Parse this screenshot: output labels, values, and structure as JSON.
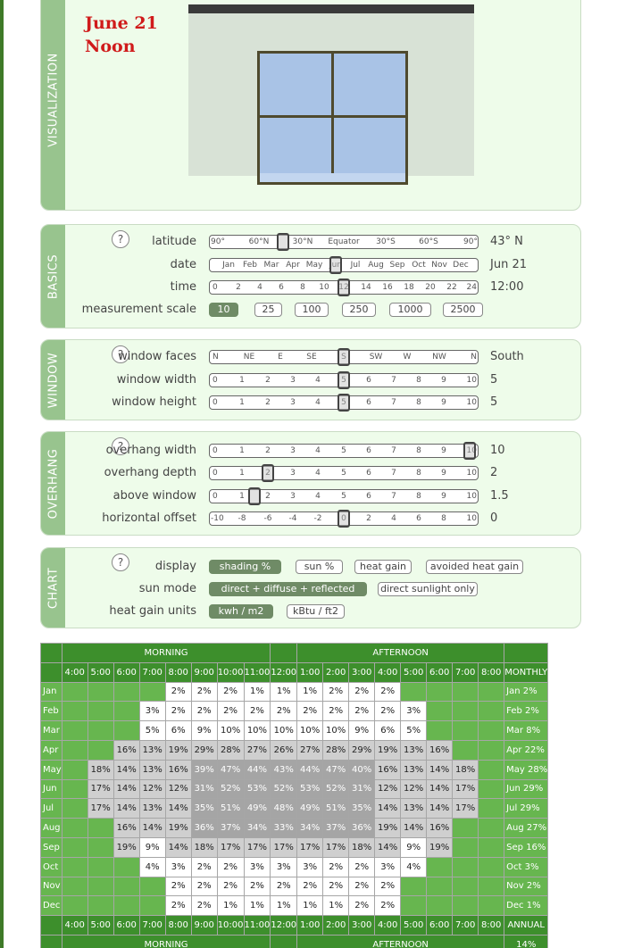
{
  "visualization": {
    "tab": "VISUALIZATION",
    "date_line": "June 21",
    "time_line": "Noon",
    "wall_color": "#d8e2d6",
    "glass_color": "#a9c3e6",
    "frame_color": "#4f4a2e"
  },
  "basics": {
    "tab": "BASICS",
    "help": "?",
    "latitude": {
      "label": "latitude",
      "ticks": [
        "90°",
        "60°N",
        "30°N",
        "Equator",
        "30°S",
        "60°S",
        "90°"
      ],
      "value": "43° N"
    },
    "date": {
      "label": "date",
      "ticks": [
        "Jan",
        "Feb",
        "Mar",
        "Apr",
        "May",
        "Jun",
        "Jul",
        "Aug",
        "Sep",
        "Oct",
        "Nov",
        "Dec"
      ],
      "value": "Jun 21"
    },
    "time": {
      "label": "time",
      "ticks": [
        "0",
        "2",
        "4",
        "6",
        "8",
        "10",
        "12",
        "14",
        "16",
        "18",
        "20",
        "22",
        "24"
      ],
      "value": "12:00"
    },
    "scale": {
      "label": "measurement scale",
      "options": [
        "10",
        "25",
        "100",
        "250",
        "1000",
        "2500"
      ],
      "selected": "10"
    }
  },
  "window": {
    "tab": "WINDOW",
    "help": "?",
    "faces": {
      "label": "window faces",
      "ticks": [
        "N",
        "NE",
        "E",
        "SE",
        "S",
        "SW",
        "W",
        "NW",
        "N"
      ],
      "value": "South"
    },
    "width": {
      "label": "window width",
      "ticks": [
        "0",
        "1",
        "2",
        "3",
        "4",
        "5",
        "6",
        "7",
        "8",
        "9",
        "10"
      ],
      "value": "5"
    },
    "height": {
      "label": "window height",
      "ticks": [
        "0",
        "1",
        "2",
        "3",
        "4",
        "5",
        "6",
        "7",
        "8",
        "9",
        "10"
      ],
      "value": "5"
    }
  },
  "overhang": {
    "tab": "OVERHANG",
    "help": "?",
    "width": {
      "label": "overhang width",
      "ticks": [
        "0",
        "1",
        "2",
        "3",
        "4",
        "5",
        "6",
        "7",
        "8",
        "9",
        "10"
      ],
      "value": "10"
    },
    "depth": {
      "label": "overhang depth",
      "ticks": [
        "0",
        "1",
        "2",
        "3",
        "4",
        "5",
        "6",
        "7",
        "8",
        "9",
        "10"
      ],
      "value": "2"
    },
    "above": {
      "label": "above window",
      "ticks": [
        "0",
        "1",
        "2",
        "3",
        "4",
        "5",
        "6",
        "7",
        "8",
        "9",
        "10"
      ],
      "value": "1.5"
    },
    "offset": {
      "label": "horizontal offset",
      "ticks": [
        "-10",
        "-8",
        "-6",
        "-4",
        "-2",
        "0",
        "2",
        "4",
        "6",
        "8",
        "10"
      ],
      "value": "0"
    }
  },
  "chart_controls": {
    "tab": "CHART",
    "help": "?",
    "display": {
      "label": "display",
      "options": [
        "shading %",
        "sun %",
        "heat gain",
        "avoided heat gain"
      ],
      "selected": "shading %"
    },
    "sun_mode": {
      "label": "sun mode",
      "options": [
        "direct + diffuse + reflected",
        "direct sunlight only"
      ],
      "selected": "direct + diffuse + reflected"
    },
    "units": {
      "label": "heat gain units",
      "options": [
        "kwh / m2",
        "kBtu / ft2"
      ],
      "selected": "kwh / m2"
    }
  },
  "table": {
    "morning": "MORNING",
    "afternoon": "AFTERNOON",
    "monthly": "MONTHLY",
    "annual": "ANNUAL",
    "annual_value": "14%",
    "hours": [
      "4:00",
      "5:00",
      "6:00",
      "7:00",
      "8:00",
      "9:00",
      "10:00",
      "11:00",
      "12:00",
      "1:00",
      "2:00",
      "3:00",
      "4:00",
      "5:00",
      "6:00",
      "7:00",
      "8:00"
    ],
    "rows": [
      {
        "month": "Jan",
        "cells": [
          "",
          "",
          "",
          "",
          "2%",
          "2%",
          "2%",
          "1%",
          "1%",
          "1%",
          "2%",
          "2%",
          "2%",
          "",
          "",
          "",
          ""
        ],
        "monthly": "Jan  2%"
      },
      {
        "month": "Feb",
        "cells": [
          "",
          "",
          "",
          "3%",
          "2%",
          "2%",
          "2%",
          "2%",
          "2%",
          "2%",
          "2%",
          "2%",
          "2%",
          "3%",
          "",
          "",
          ""
        ],
        "monthly": "Feb  2%"
      },
      {
        "month": "Mar",
        "cells": [
          "",
          "",
          "",
          "5%",
          "6%",
          "9%",
          "10%",
          "10%",
          "10%",
          "10%",
          "10%",
          "9%",
          "6%",
          "5%",
          "",
          "",
          ""
        ],
        "monthly": "Mar  8%"
      },
      {
        "month": "Apr",
        "cells": [
          "",
          "",
          "16%",
          "13%",
          "19%",
          "29%",
          "28%",
          "27%",
          "26%",
          "27%",
          "28%",
          "29%",
          "19%",
          "13%",
          "16%",
          "",
          ""
        ],
        "monthly": "Apr 22%"
      },
      {
        "month": "May",
        "cells": [
          "",
          "18%",
          "14%",
          "13%",
          "16%",
          "39%",
          "47%",
          "44%",
          "43%",
          "44%",
          "47%",
          "40%",
          "16%",
          "13%",
          "14%",
          "18%",
          ""
        ],
        "monthly": "May 28%"
      },
      {
        "month": "Jun",
        "cells": [
          "",
          "17%",
          "14%",
          "12%",
          "12%",
          "31%",
          "52%",
          "53%",
          "52%",
          "53%",
          "52%",
          "31%",
          "12%",
          "12%",
          "14%",
          "17%",
          ""
        ],
        "monthly": "Jun 29%"
      },
      {
        "month": "Jul",
        "cells": [
          "",
          "17%",
          "14%",
          "13%",
          "14%",
          "35%",
          "51%",
          "49%",
          "48%",
          "49%",
          "51%",
          "35%",
          "14%",
          "13%",
          "14%",
          "17%",
          ""
        ],
        "monthly": "Jul 29%"
      },
      {
        "month": "Aug",
        "cells": [
          "",
          "",
          "16%",
          "14%",
          "19%",
          "36%",
          "37%",
          "34%",
          "33%",
          "34%",
          "37%",
          "36%",
          "19%",
          "14%",
          "16%",
          "",
          ""
        ],
        "monthly": "Aug 27%"
      },
      {
        "month": "Sep",
        "cells": [
          "",
          "",
          "19%",
          "9%",
          "14%",
          "18%",
          "17%",
          "17%",
          "17%",
          "17%",
          "17%",
          "18%",
          "14%",
          "9%",
          "19%",
          "",
          ""
        ],
        "monthly": "Sep 16%"
      },
      {
        "month": "Oct",
        "cells": [
          "",
          "",
          "",
          "4%",
          "3%",
          "2%",
          "2%",
          "3%",
          "3%",
          "3%",
          "2%",
          "2%",
          "3%",
          "4%",
          "",
          "",
          ""
        ],
        "monthly": "Oct  3%"
      },
      {
        "month": "Nov",
        "cells": [
          "",
          "",
          "",
          "",
          "2%",
          "2%",
          "2%",
          "2%",
          "2%",
          "2%",
          "2%",
          "2%",
          "2%",
          "",
          "",
          "",
          ""
        ],
        "monthly": "Nov  2%"
      },
      {
        "month": "Dec",
        "cells": [
          "",
          "",
          "",
          "",
          "2%",
          "2%",
          "1%",
          "1%",
          "1%",
          "1%",
          "1%",
          "2%",
          "2%",
          "",
          "",
          "",
          ""
        ],
        "monthly": "Dec  1%"
      }
    ]
  }
}
